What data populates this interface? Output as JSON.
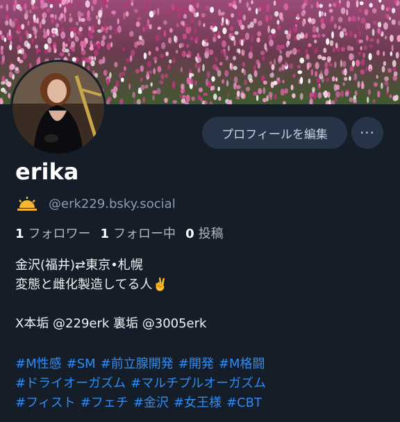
{
  "profile": {
    "display_name": "erika",
    "handle": "@erk229.bsky.social",
    "handle_emoji": "sunrise-icon",
    "edit_button_label": "プロフィールを編集",
    "more_button_label": "···",
    "stats": {
      "followers_count": "1",
      "followers_label": "フォロワー",
      "following_count": "1",
      "following_label": "フォロー中",
      "posts_count": "0",
      "posts_label": "投稿"
    },
    "bio_lines": [
      "金沢(福井)⇄東京•札幌",
      "変態と雌化製造してる人✌️",
      "",
      "X本垢 @229erk  裏垢 @3005erk"
    ],
    "hashtag_lines": [
      [
        "#M性感",
        "#SM",
        "#前立腺開発",
        "#開発",
        "#M格闘"
      ],
      [
        "#ドライオーガズム",
        "#マルチプルオーガズム"
      ],
      [
        "#フィスト",
        "#フェチ",
        "#金沢",
        "#女王様",
        "#CBT"
      ]
    ]
  },
  "colors": {
    "background": "#151d28",
    "button_bg": "#273447",
    "hashtag": "#2e8cf2",
    "muted_text": "#8e9cad"
  }
}
